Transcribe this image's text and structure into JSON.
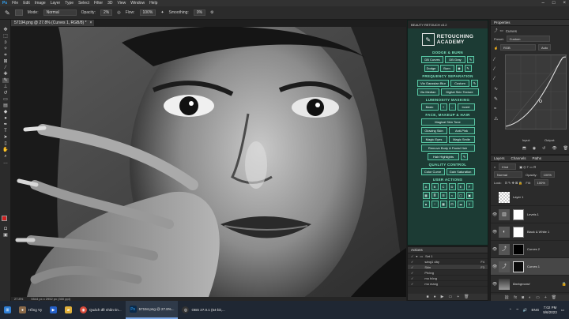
{
  "menu": [
    "Ps",
    "File",
    "Edit",
    "Image",
    "Layer",
    "Type",
    "Select",
    "Filter",
    "3D",
    "View",
    "Window",
    "Help"
  ],
  "options": {
    "mode_label": "Mode:",
    "mode_value": "Normal",
    "opacity_label": "Opacity:",
    "opacity_value": "2%",
    "flow_label": "Flow:",
    "flow_value": "100%",
    "smoothing_label": "Smoothing:",
    "smoothing_value": "0%"
  },
  "document": {
    "tab_title": "57194.png @ 27.8% (Curves 1, RGB/8) *",
    "zoom": "27.8%",
    "doc_info": "5544 px x 2952 px (300 ppi)"
  },
  "plugin": {
    "title": "BEAUTY RETOUCH v3.2",
    "logo_line1": "RETOUCHING",
    "logo_line2": "ACADEMY",
    "sections": {
      "dodge_burn": "DODGE & BURN",
      "freq_sep": "FREQUENCY SEPARATION",
      "lum_mask": "LUMINOSITY MASKING",
      "face": "FACE, MAKEUP & HAIR",
      "quality": "QUALITY CONTROL",
      "user": "USER ACTIONS"
    },
    "db": [
      "DB Curves",
      "DB Gray",
      "Dodge",
      "Burn"
    ],
    "fs": [
      "Via Gaussian Blur",
      "Custom",
      "Via Median",
      "Digital Skin Texture"
    ],
    "lum": [
      "Basic",
      "+",
      "-",
      "Invert"
    ],
    "face": [
      "Magical Skin Tone",
      "Glowing Skin",
      "Anti-Pink",
      "Magic Eyes",
      "Magic Smile",
      "Remove Body & Facial Hair",
      "Hair Highlights"
    ],
    "qc": [
      "Color Curve",
      "Gain Saturation"
    ],
    "letters": [
      "A",
      "B",
      "C",
      "D",
      "E",
      "F"
    ]
  },
  "actions": {
    "title": "Actions",
    "rows": [
      "Set 1",
      "sáng1 dây",
      "Skin",
      "Phông",
      "mo hông",
      "mo mang"
    ],
    "shortcuts": [
      "",
      "F4",
      "F3",
      "",
      "",
      ""
    ]
  },
  "properties": {
    "title": "Properties",
    "adj_name": "Curves",
    "preset_label": "Preset:",
    "preset_value": "Custom",
    "channel_value": "RGB",
    "auto_label": "Auto",
    "input_label": "Input:",
    "output_label": "Output:"
  },
  "layers": {
    "tabs": [
      "Layers",
      "Channels",
      "Paths"
    ],
    "kind_label": "Kind",
    "blend_value": "Normal",
    "opacity_label": "Opacity:",
    "opacity_value": "100%",
    "lock_label": "Lock:",
    "fill_label": "Fill:",
    "fill_value": "100%",
    "items": [
      "Layer 1",
      "Levels 1",
      "Black & White 1",
      "Curves 2",
      "Curves 1",
      "Background"
    ]
  },
  "taskbar": {
    "items": [
      "Hồng Vy",
      "Quách đề nhân tin...",
      "57194.png @ 27.8%...",
      "OBS 27.0.1 (64-bit,..."
    ],
    "lang": "ENG",
    "time": "7:02 PM",
    "date": "9/6/2023"
  },
  "colors": {
    "plugin_bg": "#1c3b34",
    "plugin_accent": "#58c6a3",
    "panel_bg": "#2b2b2b",
    "foreground_swatch": "#d02020"
  }
}
